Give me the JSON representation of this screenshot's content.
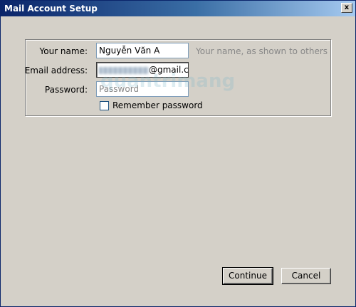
{
  "window": {
    "title": "Mail Account Setup",
    "close_glyph": "x"
  },
  "form": {
    "name_label": "Your name:",
    "name_value": "Nguyễn Văn A",
    "name_hint": "Your name, as shown to others",
    "email_label": "Email address:",
    "email_visible_suffix": "@gmail.com",
    "password_label": "Password:",
    "password_placeholder": "Password",
    "remember_label": "Remember password",
    "remember_checked": false
  },
  "buttons": {
    "continue_label": "Continue",
    "cancel_label": "Cancel"
  },
  "watermark": "quantrimang"
}
